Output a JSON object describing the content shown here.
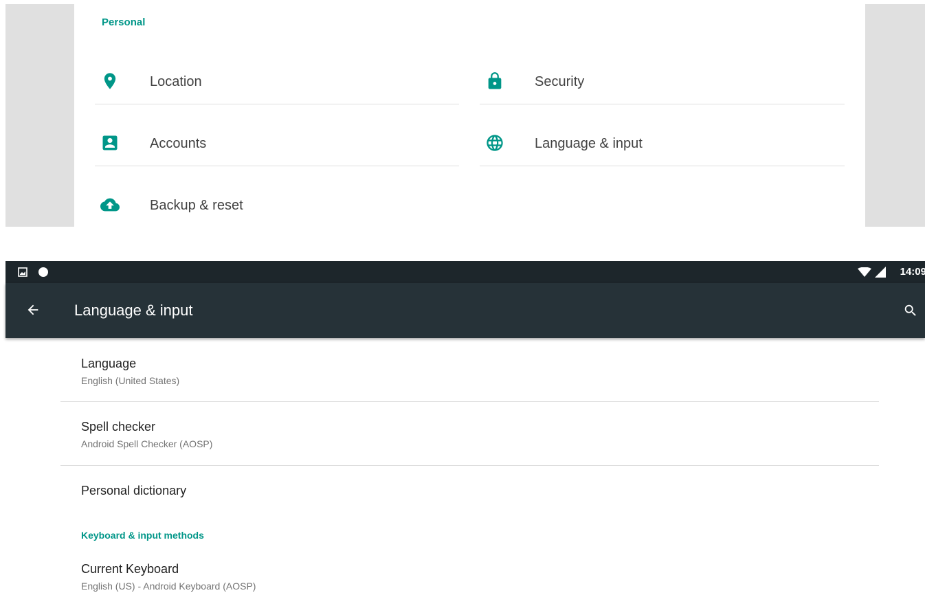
{
  "settings": {
    "section_title": "Personal",
    "tiles": [
      {
        "label": "Location",
        "icon": "location-pin-icon"
      },
      {
        "label": "Security",
        "icon": "lock-icon"
      },
      {
        "label": "Accounts",
        "icon": "account-box-icon"
      },
      {
        "label": "Language & input",
        "icon": "globe-icon"
      },
      {
        "label": "Backup & reset",
        "icon": "cloud-upload-icon"
      }
    ]
  },
  "status_bar": {
    "time": "14:09"
  },
  "app_bar": {
    "title": "Language & input"
  },
  "prefs": [
    {
      "title": "Language",
      "summary": "English (United States)"
    },
    {
      "title": "Spell checker",
      "summary": "Android Spell Checker (AOSP)"
    },
    {
      "title": "Personal dictionary"
    }
  ],
  "keyboard_section": {
    "title": "Keyboard & input methods",
    "current_keyboard": {
      "title": "Current Keyboard",
      "summary": "English (US) - Android Keyboard (AOSP)"
    }
  },
  "colors": {
    "accent": "#009688",
    "toolbar": "#263238",
    "status_bar": "#1d262b"
  }
}
